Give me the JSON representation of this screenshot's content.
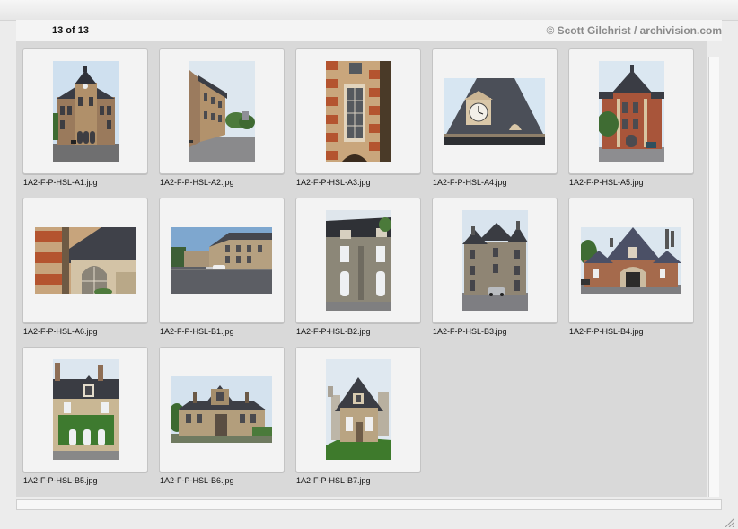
{
  "header": {
    "counter": "13 of 13",
    "copyright": "© Scott Gilchrist / archivision.com"
  },
  "thumbnails": [
    {
      "label": "1A2-F-P-HSL-A1.jpg",
      "icon": "building-facade-photo"
    },
    {
      "label": "1A2-F-P-HSL-A2.jpg",
      "icon": "building-street-photo"
    },
    {
      "label": "1A2-F-P-HSL-A3.jpg",
      "icon": "window-detail-photo"
    },
    {
      "label": "1A2-F-P-HSL-A4.jpg",
      "icon": "clock-gable-photo"
    },
    {
      "label": "1A2-F-P-HSL-A5.jpg",
      "icon": "brick-pavilion-photo"
    },
    {
      "label": "1A2-F-P-HSL-A6.jpg",
      "icon": "arched-doorway-photo"
    },
    {
      "label": "1A2-F-P-HSL-B1.jpg",
      "icon": "courtyard-street-photo"
    },
    {
      "label": "1A2-F-P-HSL-B2.jpg",
      "icon": "stone-facade-photo"
    },
    {
      "label": "1A2-F-P-HSL-B3.jpg",
      "icon": "stone-building-photo"
    },
    {
      "label": "1A2-F-P-HSL-B4.jpg",
      "icon": "gatehouse-photo"
    },
    {
      "label": "1A2-F-P-HSL-B5.jpg",
      "icon": "ivy-house-photo"
    },
    {
      "label": "1A2-F-P-HSL-B6.jpg",
      "icon": "stone-house-photo"
    },
    {
      "label": "1A2-F-P-HSL-B7.jpg",
      "icon": "small-pavilion-photo"
    }
  ]
}
